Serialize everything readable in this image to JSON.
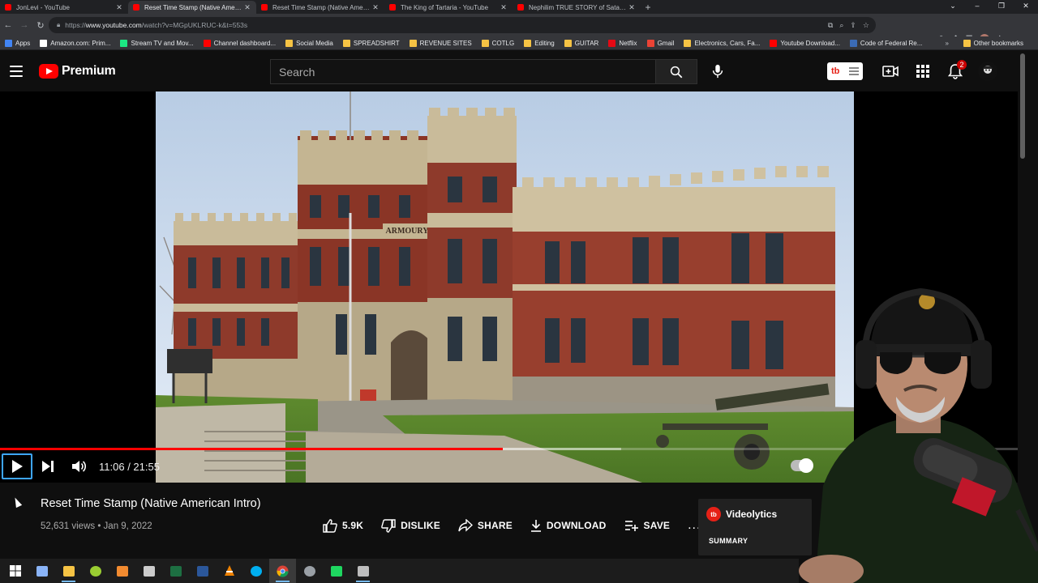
{
  "browser": {
    "tabs": [
      {
        "title": "JonLevi - YouTube",
        "active": false
      },
      {
        "title": "Reset Time Stamp (Native Ameri...",
        "active": true
      },
      {
        "title": "Reset Time Stamp (Native Ameri...",
        "active": false
      },
      {
        "title": "The King of Tartaria - YouTube",
        "active": false
      },
      {
        "title": "Nephilim TRUE STORY of Satan...",
        "active": false
      }
    ],
    "new_tab": "+",
    "window_controls": [
      "⌄",
      "–",
      "❐",
      "✕"
    ],
    "url_host": "www.youtube.com",
    "url_prefix": "https://",
    "url_path": "/watch?v=MGpUKLRUC-k&t=553s",
    "bookmarks": [
      {
        "label": "Apps",
        "color": "#4285f4"
      },
      {
        "label": "Amazon.com: Prim...",
        "color": "#ffffff"
      },
      {
        "label": "Stream TV and Mov...",
        "color": "#1ce783"
      },
      {
        "label": "Channel dashboard...",
        "color": "#ff0000"
      },
      {
        "label": "Social Media",
        "color": "#f6c344"
      },
      {
        "label": "SPREADSHIRT",
        "color": "#f6c344"
      },
      {
        "label": "REVENUE SITES",
        "color": "#f6c344"
      },
      {
        "label": "COTLG",
        "color": "#f6c344"
      },
      {
        "label": "Editing",
        "color": "#f6c344"
      },
      {
        "label": "GUITAR",
        "color": "#f6c344"
      },
      {
        "label": "Netflix",
        "color": "#e50914"
      },
      {
        "label": "Gmail",
        "color": "#ea4335"
      },
      {
        "label": "Electronics, Cars, Fa...",
        "color": "#f6c344"
      },
      {
        "label": "Youtube Download...",
        "color": "#ff0000"
      },
      {
        "label": "Code of Federal Re...",
        "color": "#3b6bb5"
      }
    ],
    "bookmarks_more": "»",
    "other_bookmarks": "Other bookmarks"
  },
  "youtube": {
    "logo_text": "Premium",
    "search_placeholder": "Search",
    "notification_count": "2",
    "extension_label": "tb",
    "brand_red": "#ff0000"
  },
  "player": {
    "current_time": "11:06",
    "duration": "21:55",
    "time_separator": " / ",
    "played_fraction": 0.4937,
    "loaded_fraction": 0.61,
    "progress_color": "#ff0000"
  },
  "video": {
    "title": "Reset Time Stamp (Native American Intro)",
    "views": "52,631 views",
    "date": "Jan 9, 2022",
    "meta_separator": " • ",
    "likes": "5.9K",
    "dislike_label": "DISLIKE",
    "share_label": "SHARE",
    "download_label": "DOWNLOAD",
    "save_label": "SAVE",
    "more_label": "..."
  },
  "videolytics": {
    "name": "Videolytics",
    "logo": "tb",
    "summary_label": "SUMMARY"
  },
  "building_sign": "ARMOURY",
  "taskbar": {
    "items": [
      {
        "name": "windows-start-icon",
        "color": "#ffffff"
      },
      {
        "name": "calculator-app-icon",
        "color": "#8ab4f8"
      },
      {
        "name": "file-explorer-icon",
        "color": "#f6c344"
      },
      {
        "name": "paint-app-icon",
        "color": "#9acd32"
      },
      {
        "name": "media-app-icon",
        "color": "#f28b30"
      },
      {
        "name": "plane-app-icon",
        "color": "#cccccc"
      },
      {
        "name": "excel-icon",
        "color": "#1d6f42"
      },
      {
        "name": "word-icon",
        "color": "#2b579a"
      },
      {
        "name": "vlc-icon",
        "color": "#f08200"
      },
      {
        "name": "skype-icon",
        "color": "#00aff0"
      },
      {
        "name": "chrome-icon",
        "color": "#db4437"
      },
      {
        "name": "settings-app-icon",
        "color": "#9aa0a6"
      },
      {
        "name": "green-app-icon",
        "color": "#1ed760"
      },
      {
        "name": "screen-recorder-icon",
        "color": "#bdbdbd"
      }
    ]
  }
}
